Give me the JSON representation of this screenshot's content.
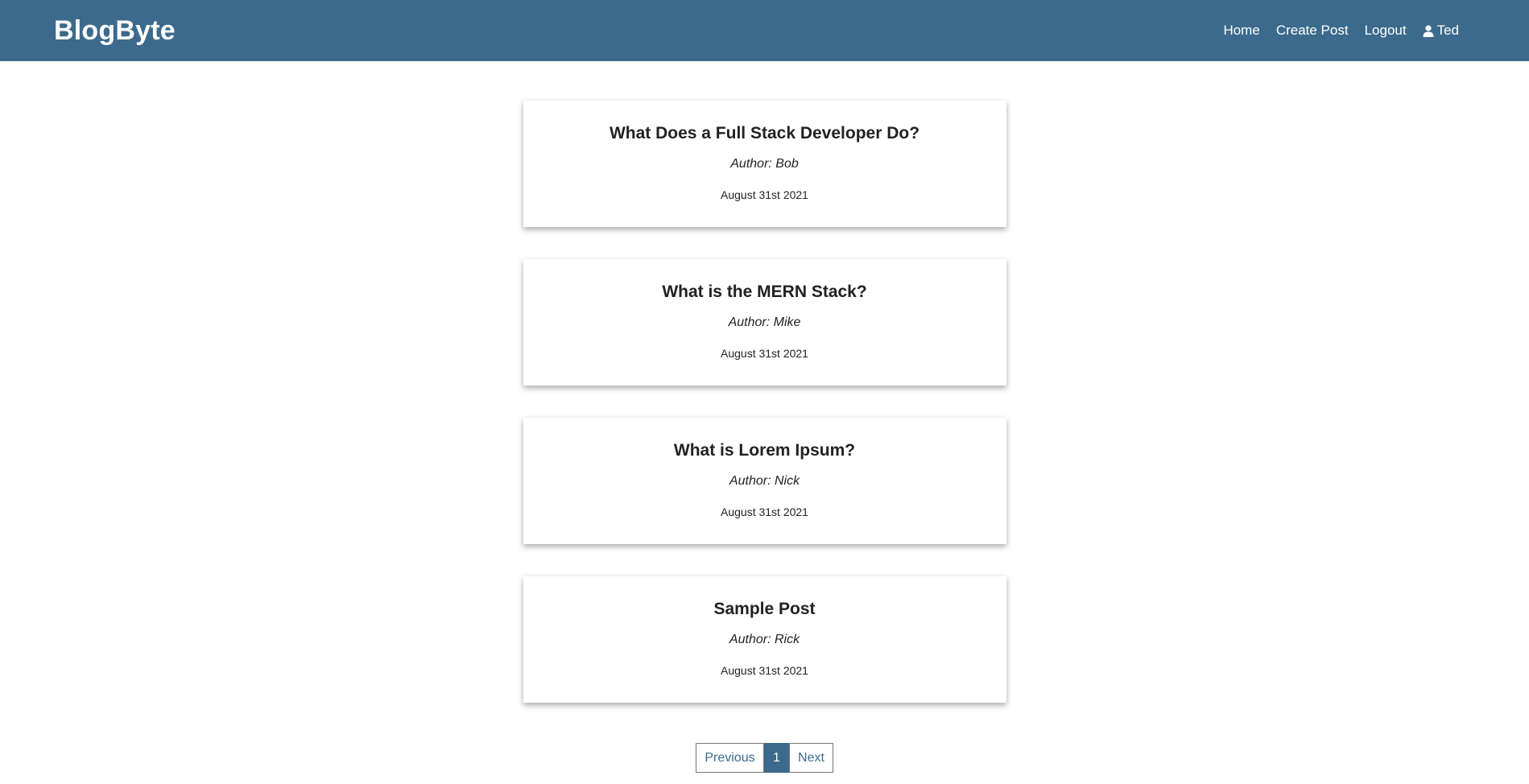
{
  "header": {
    "brand": "BlogByte",
    "nav": {
      "home": "Home",
      "create_post": "Create Post",
      "logout": "Logout",
      "user": "Ted",
      "user_icon": "user-icon"
    }
  },
  "posts": [
    {
      "title": "What Does a Full Stack Developer Do?",
      "author": "Author: Bob",
      "date": "August 31st 2021"
    },
    {
      "title": "What is the MERN Stack?",
      "author": "Author: Mike",
      "date": "August 31st 2021"
    },
    {
      "title": "What is Lorem Ipsum?",
      "author": "Author: Nick",
      "date": "August 31st 2021"
    },
    {
      "title": "Sample Post",
      "author": "Author: Rick",
      "date": "August 31st 2021"
    }
  ],
  "pagination": {
    "previous": "Previous",
    "current": "1",
    "next": "Next"
  },
  "colors": {
    "navbar": "#3b6a8c",
    "link": "#3b6a8c",
    "text": "#222222"
  }
}
